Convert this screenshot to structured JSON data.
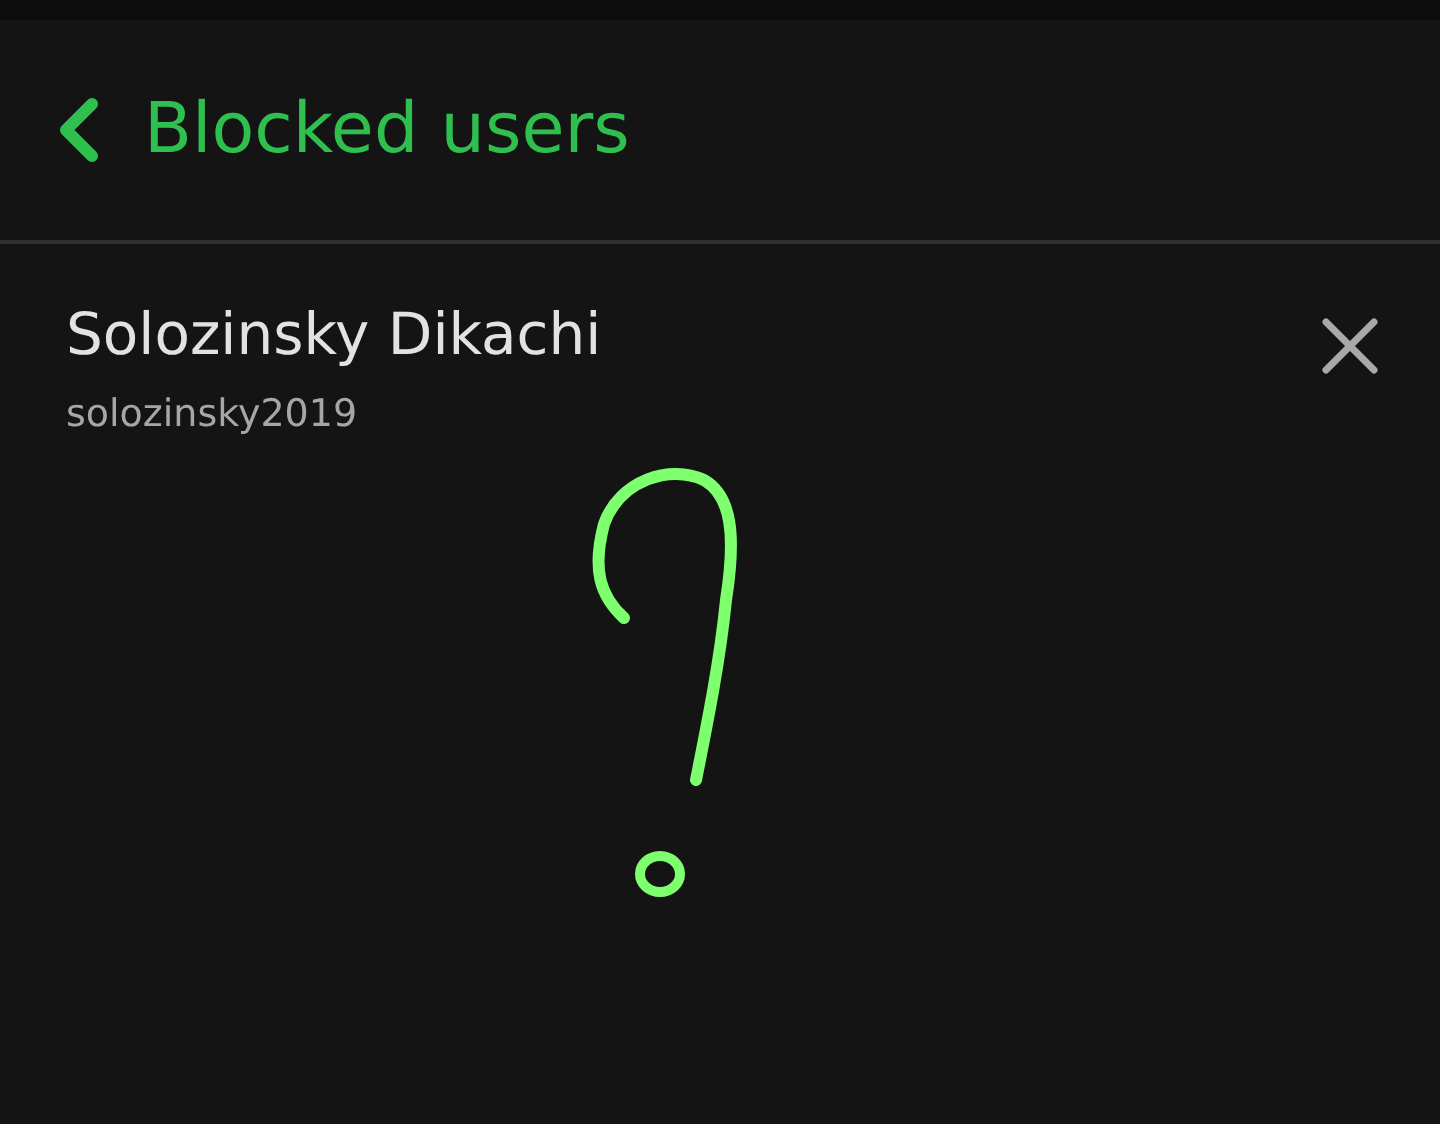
{
  "header": {
    "title": "Blocked users"
  },
  "blocked_users": [
    {
      "name": "Solozinsky Dikachi",
      "username": "solozinsky2019"
    }
  ]
}
